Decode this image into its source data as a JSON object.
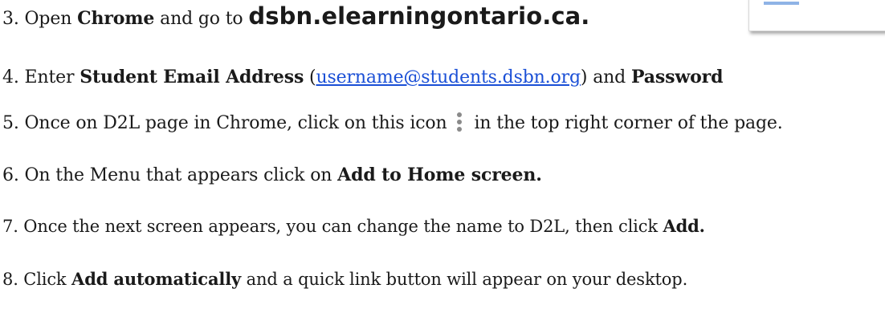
{
  "steps": {
    "s3": {
      "num": "3.",
      "pre": " Open ",
      "b1": "Chrome",
      "mid": " and go to ",
      "domain": "dsbn.elearningontario.ca."
    },
    "s4": {
      "num": "4.",
      "pre": " Enter ",
      "b1": "Student Email Address",
      "open": " (",
      "link": "username@students.dsbn.org",
      "mid": ") and ",
      "b2": "Password"
    },
    "s5": {
      "num": "5.",
      "pre": " Once on D2L page in Chrome, click on this icon",
      "post": "in the top right corner of the page.",
      "icon": "kebab-menu-icon"
    },
    "s6": {
      "num": "6.",
      "pre": " On the Menu that appears click on ",
      "b1": "Add to Home screen."
    },
    "s7": {
      "num": "7.",
      "pre": " Once the next screen appears, you can change the name to D2L, then click ",
      "b1": "Add."
    },
    "s8": {
      "num": "8.",
      "pre": " Click ",
      "b1": "Add automatically",
      "post": " and a quick link button will appear on your desktop."
    }
  },
  "colors": {
    "text": "#1a1a1a",
    "link": "#1a4fd6",
    "icon": "#8a8a8a"
  }
}
